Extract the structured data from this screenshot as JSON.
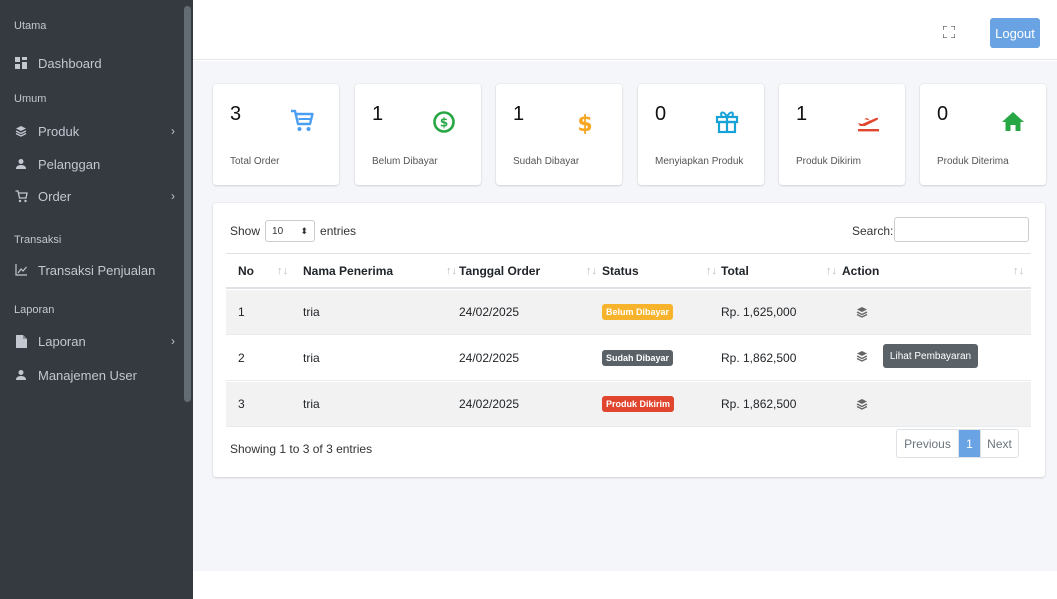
{
  "sidebar": {
    "sections": [
      "Utama",
      "Umum",
      "Transaksi",
      "Laporan"
    ],
    "items": [
      {
        "label": "Dashboard",
        "icon": "dashboard-icon"
      },
      {
        "label": "Produk",
        "icon": "layers-icon"
      },
      {
        "label": "Pelanggan",
        "icon": "user-icon"
      },
      {
        "label": "Order",
        "icon": "cart-icon"
      },
      {
        "label": "Transaksi Penjualan",
        "icon": "line-chart-icon"
      },
      {
        "label": "Laporan",
        "icon": "file-icon"
      },
      {
        "label": "Manajemen User",
        "icon": "user-icon"
      }
    ]
  },
  "header": {
    "logout_label": "Logout",
    "expand_icon": "expand-icon"
  },
  "stats": [
    {
      "value": "3",
      "label": "Total Order",
      "icon": "cart-icon",
      "color": "#4a9ff5"
    },
    {
      "value": "1",
      "label": "Belum Dibayar",
      "icon": "dollar-circle-icon",
      "color": "#28a745"
    },
    {
      "value": "1",
      "label": "Sudah Dibayar",
      "icon": "dollar-icon",
      "color": "#f5a623"
    },
    {
      "value": "0",
      "label": "Menyiapkan Produk",
      "icon": "gift-icon",
      "color": "#17a2d8"
    },
    {
      "value": "1",
      "label": "Produk Dikirim",
      "icon": "plane-departure-icon",
      "color": "#e0452e"
    },
    {
      "value": "0",
      "label": "Produk Diterima",
      "icon": "home-icon",
      "color": "#28a745"
    }
  ],
  "table": {
    "show_label": "Show",
    "entries_value": "10",
    "entries_label": "entries",
    "search_label": "Search:",
    "columns": [
      "No",
      "Nama Penerima",
      "Tanggal Order",
      "Status",
      "Total",
      "Action"
    ],
    "rows": [
      {
        "no": "1",
        "nama": "tria",
        "tanggal": "24/02/2025",
        "status": "Belum Dibayar",
        "status_color": "#f7b32b",
        "total": "Rp. 1,625,000"
      },
      {
        "no": "2",
        "nama": "tria",
        "tanggal": "24/02/2025",
        "status": "Sudah Dibayar",
        "status_color": "#5a6268",
        "total": "Rp. 1,862,500"
      },
      {
        "no": "3",
        "nama": "tria",
        "tanggal": "24/02/2025",
        "status": "Produk Dikirim",
        "status_color": "#e0452e",
        "total": "Rp. 1,862,500"
      }
    ],
    "tooltip": "Lihat Pembayaran",
    "info": "Showing 1 to 3 of 3 entries",
    "pagination": {
      "previous": "Previous",
      "current": "1",
      "next": "Next"
    }
  }
}
